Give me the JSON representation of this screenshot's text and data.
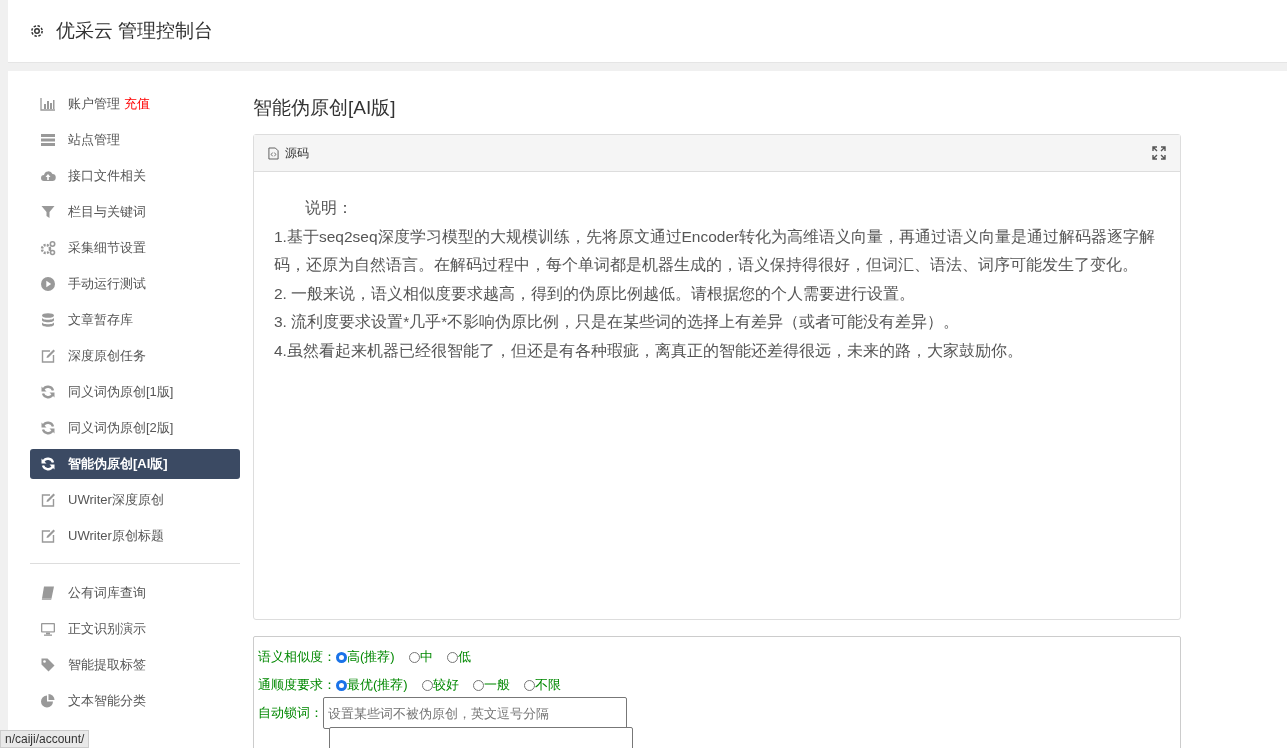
{
  "header": {
    "title": "优采云 管理控制台"
  },
  "sidebar": {
    "groups": [
      {
        "items": [
          {
            "label": "账户管理",
            "badge": "充值",
            "selected": false
          },
          {
            "label": "站点管理",
            "selected": false
          },
          {
            "label": "接口文件相关",
            "selected": false
          },
          {
            "label": "栏目与关键词",
            "selected": false
          },
          {
            "label": "采集细节设置",
            "selected": false
          },
          {
            "label": "手动运行测试",
            "selected": false
          },
          {
            "label": "文章暂存库",
            "selected": false
          },
          {
            "label": "深度原创任务",
            "selected": false
          },
          {
            "label": "同义词伪原创[1版]",
            "selected": false
          },
          {
            "label": "同义词伪原创[2版]",
            "selected": false
          },
          {
            "label": "智能伪原创[AI版]",
            "selected": true
          },
          {
            "label": "UWriter深度原创",
            "selected": false
          },
          {
            "label": "UWriter原创标题",
            "selected": false
          }
        ]
      },
      {
        "items": [
          {
            "label": "公有词库查询",
            "selected": false
          },
          {
            "label": "正文识别演示",
            "selected": false
          },
          {
            "label": "智能提取标签",
            "selected": false
          },
          {
            "label": "文本智能分类",
            "selected": false
          }
        ]
      }
    ]
  },
  "page_title": "智能伪原创[AI版]",
  "source_panel": {
    "tab": "源码",
    "heading": "说明：",
    "paragraphs": [
      "1.基于seq2seq深度学习模型的大规模训练，先将原文通过Encoder转化为高维语义向量，再通过语义向量是通过解码器逐字解码，还原为自然语言。在解码过程中，每个单词都是机器生成的，语义保持得很好，但词汇、语法、词序可能发生了变化。",
      "2. 一般来说，语义相似度要求越高，得到的伪原比例越低。请根据您的个人需要进行设置。",
      "3. 流利度要求设置*几乎*不影响伪原比例，只是在某些词的选择上有差异（或者可能没有差异）。",
      "4.虽然看起来机器已经很智能了，但还是有各种瑕疵，离真正的智能还差得很远，未来的路，大家鼓励你。"
    ]
  },
  "form": {
    "rows": [
      {
        "kind": "radio",
        "label": "语义相似度：",
        "options": [
          {
            "label": "高(推荐)",
            "selected": true
          },
          {
            "label": "中",
            "selected": false
          },
          {
            "label": "低",
            "selected": false
          }
        ]
      },
      {
        "kind": "radio",
        "label": "通顺度要求：",
        "options": [
          {
            "label": "最优(推荐)",
            "selected": true
          },
          {
            "label": "较好",
            "selected": false
          },
          {
            "label": "一般",
            "selected": false
          },
          {
            "label": "不限",
            "selected": false
          }
        ]
      },
      {
        "kind": "text",
        "label": "自动锁词：",
        "placeholder": "设置某些词不被伪原创，英文逗号分隔"
      }
    ]
  },
  "status_bar": {
    "url": "n/caiji/account/"
  }
}
